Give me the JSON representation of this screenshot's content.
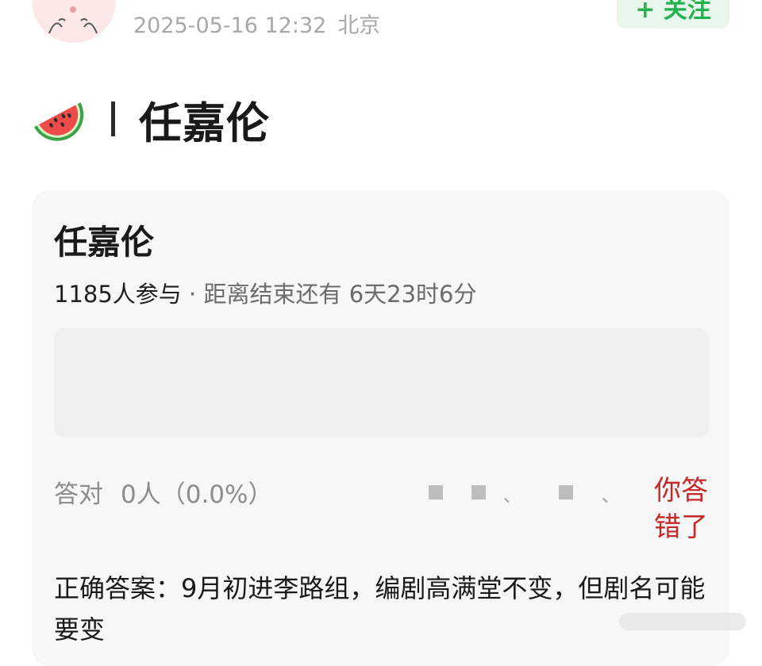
{
  "post": {
    "timestamp": "2025-05-16 12:32",
    "location": "北京",
    "follow_label": "+ 关注",
    "title": "任嘉伦"
  },
  "poll": {
    "title": "任嘉伦",
    "participants": "1185人参与",
    "separator": " · ",
    "countdown_prefix": "距离结束还有 ",
    "countdown": "6天23时6分",
    "correct_label": "答对",
    "correct_value": "0人（0.0%）",
    "censored_separator": "、",
    "wrong_label": "你答错了",
    "answer_text": "正确答案：9月初进李路组，编剧高满堂不变，但剧名可能要变"
  },
  "icons": {
    "title_icon": "watermelon-icon",
    "avatar": "avatar-image"
  },
  "colors": {
    "follow_text": "#23b14d",
    "follow_bg": "#e8f7ec",
    "wrong_answer": "#c62828",
    "card_bg": "#f7f7f7",
    "meta_text": "#a8a8a8"
  }
}
